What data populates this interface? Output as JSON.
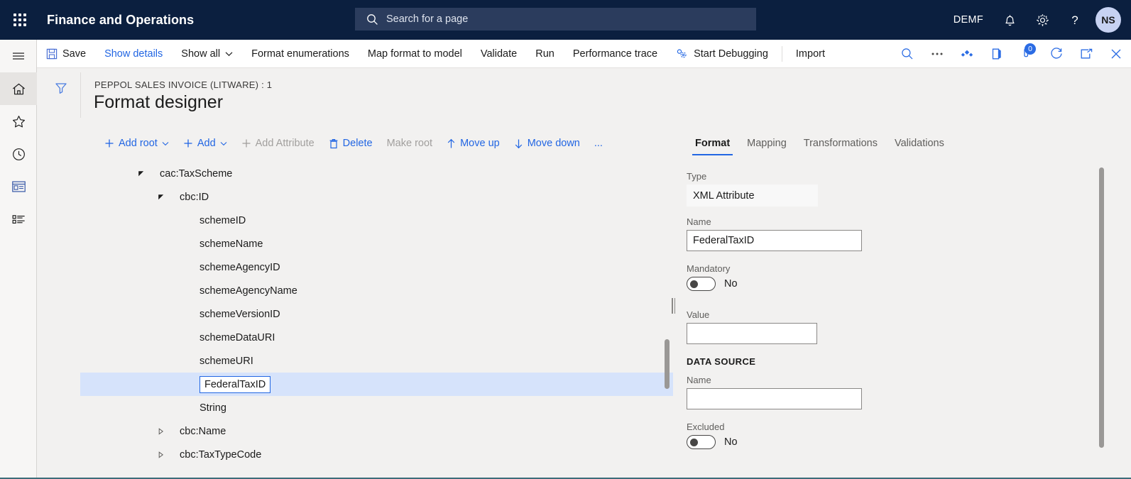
{
  "topbar": {
    "waffle_icon": "app-launcher-icon",
    "app_title": "Finance and Operations",
    "search_icon": "search-icon",
    "search_placeholder": "Search for a page",
    "company": "DEMF",
    "notification_icon": "bell-icon",
    "settings_icon": "gear-icon",
    "help_icon": "question-mark-icon",
    "avatar_initials": "NS",
    "bg_color": "#0b1f3f",
    "search_bg_color": "#2b3c5d"
  },
  "rail": {
    "items": [
      {
        "name": "hamburger",
        "icon": "hamburger-menu-icon",
        "active": false
      },
      {
        "name": "home",
        "icon": "home-icon",
        "active": true
      },
      {
        "name": "favorites",
        "icon": "star-icon",
        "active": false
      },
      {
        "name": "recent",
        "icon": "clock-icon",
        "active": false
      },
      {
        "name": "workspaces",
        "icon": "workspace-icon",
        "active": false
      },
      {
        "name": "modules",
        "icon": "modules-list-icon",
        "active": false
      }
    ]
  },
  "commandbar": {
    "save_label": "Save",
    "save_icon": "save-disk-icon",
    "items": [
      {
        "label": "Show details",
        "style": "link"
      },
      {
        "label": "Show all",
        "style": "normal",
        "caret": true
      },
      {
        "label": "Format enumerations",
        "style": "normal"
      },
      {
        "label": "Map format to model",
        "style": "normal"
      },
      {
        "label": "Validate",
        "style": "normal"
      },
      {
        "label": "Run",
        "style": "normal"
      },
      {
        "label": "Performance trace",
        "style": "normal"
      },
      {
        "label": "Start Debugging",
        "style": "normal",
        "icon": "debug-gears-icon"
      }
    ],
    "import_label": "Import",
    "right_icons": [
      {
        "name": "search-icon",
        "badge": null
      },
      {
        "name": "overflow-ellipsis-icon",
        "badge": null
      },
      {
        "name": "attachments-icon",
        "badge": null
      },
      {
        "name": "office-apps-icon",
        "badge": null
      },
      {
        "name": "messages-icon",
        "badge": "0"
      },
      {
        "name": "refresh-icon",
        "badge": null
      },
      {
        "name": "popout-icon",
        "badge": null
      },
      {
        "name": "close-icon",
        "badge": null
      }
    ]
  },
  "pageheader": {
    "filter_icon": "filter-funnel-icon",
    "breadcrumb": "PEPPOL SALES INVOICE (LITWARE) : 1",
    "title": "Format designer"
  },
  "treetools": [
    {
      "label": "Add root",
      "icon": "plus-icon",
      "caret": true,
      "disabled": false
    },
    {
      "label": "Add",
      "icon": "plus-icon",
      "caret": true,
      "disabled": false
    },
    {
      "label": "Add Attribute",
      "icon": "plus-icon",
      "caret": false,
      "disabled": true
    },
    {
      "label": "Delete",
      "icon": "trash-icon",
      "caret": false,
      "disabled": false
    },
    {
      "label": "Make root",
      "icon": null,
      "caret": false,
      "disabled": true
    },
    {
      "label": "Move up",
      "icon": "arrow-up-icon",
      "caret": false,
      "disabled": false
    },
    {
      "label": "Move down",
      "icon": "arrow-down-icon",
      "caret": false,
      "disabled": false
    },
    {
      "label": "...",
      "icon": null,
      "caret": false,
      "disabled": false
    }
  ],
  "tree": {
    "rows": [
      {
        "label": "cac:TaxScheme",
        "indent": 0,
        "chevron": "expanded",
        "selected": false,
        "editing": false
      },
      {
        "label": "cbc:ID",
        "indent": 1,
        "chevron": "expanded",
        "selected": false,
        "editing": false
      },
      {
        "label": "schemeID",
        "indent": 2,
        "chevron": "none",
        "selected": false,
        "editing": false
      },
      {
        "label": "schemeName",
        "indent": 2,
        "chevron": "none",
        "selected": false,
        "editing": false
      },
      {
        "label": "schemeAgencyID",
        "indent": 2,
        "chevron": "none",
        "selected": false,
        "editing": false
      },
      {
        "label": "schemeAgencyName",
        "indent": 2,
        "chevron": "none",
        "selected": false,
        "editing": false
      },
      {
        "label": "schemeVersionID",
        "indent": 2,
        "chevron": "none",
        "selected": false,
        "editing": false
      },
      {
        "label": "schemeDataURI",
        "indent": 2,
        "chevron": "none",
        "selected": false,
        "editing": false
      },
      {
        "label": "schemeURI",
        "indent": 2,
        "chevron": "none",
        "selected": false,
        "editing": false
      },
      {
        "label": "FederalTaxID",
        "indent": 2,
        "chevron": "none",
        "selected": true,
        "editing": true
      },
      {
        "label": "String",
        "indent": 2,
        "chevron": "none",
        "selected": false,
        "editing": false
      },
      {
        "label": "cbc:Name",
        "indent": 1,
        "chevron": "collapsed",
        "selected": false,
        "editing": false
      },
      {
        "label": "cbc:TaxTypeCode",
        "indent": 1,
        "chevron": "collapsed",
        "selected": false,
        "editing": false
      }
    ]
  },
  "detail": {
    "tabs": [
      {
        "label": "Format",
        "active": true
      },
      {
        "label": "Mapping",
        "active": false
      },
      {
        "label": "Transformations",
        "active": false
      },
      {
        "label": "Validations",
        "active": false
      }
    ],
    "type_label": "Type",
    "type_value": "XML Attribute",
    "name_label": "Name",
    "name_value": "FederalTaxID",
    "mandatory_label": "Mandatory",
    "mandatory_value": "No",
    "value_label": "Value",
    "value_value": "",
    "datasource_header": "DATA SOURCE",
    "ds_name_label": "Name",
    "ds_name_value": "",
    "excluded_label": "Excluded",
    "excluded_value": "No"
  },
  "colors": {
    "accent": "#2266e3",
    "nav_bg": "#0b1f3f",
    "page_bg": "#f2f1f0",
    "selection_bg": "#d6e3fb"
  }
}
